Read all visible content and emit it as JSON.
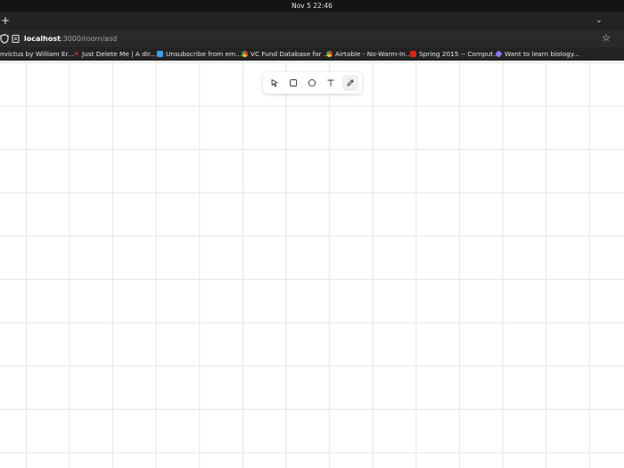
{
  "system": {
    "clock": "Nov 5  22:46"
  },
  "browser": {
    "new_tab_glyph": "+",
    "tab_menu_glyph": "⌄",
    "url_host": "localhost",
    "url_path": ":3000/room/asd",
    "star_glyph": "☆"
  },
  "bookmarks": [
    {
      "label": "nvictus by William Er...",
      "icon": "none"
    },
    {
      "label": "Just Delete Me | A dir...",
      "icon": "x-icon",
      "color": "#d93b3b"
    },
    {
      "label": "Unsubscribe from em...",
      "icon": "unroll-icon",
      "color": "#3aa0e8"
    },
    {
      "label": "VC Fund Database for ...",
      "icon": "chrome-icon",
      "color": "#e8a33a"
    },
    {
      "label": "Airtable - No-Warm-In...",
      "icon": "chrome-icon",
      "color": "#e8a33a"
    },
    {
      "label": "Spring 2015 -- Comput...",
      "icon": "youtube-icon",
      "color": "#e62117"
    },
    {
      "label": "Want to learn biology...",
      "icon": "gem-icon",
      "color": "#6a7cf0"
    }
  ],
  "toolbar": {
    "tools": [
      {
        "name": "select",
        "icon": "cursor-icon",
        "active": false
      },
      {
        "name": "rectangle",
        "icon": "square-icon",
        "active": false
      },
      {
        "name": "ellipse",
        "icon": "circle-icon",
        "active": false
      },
      {
        "name": "text",
        "icon": "text-icon",
        "active": false
      },
      {
        "name": "pencil",
        "icon": "pencil-icon",
        "active": true
      }
    ]
  }
}
